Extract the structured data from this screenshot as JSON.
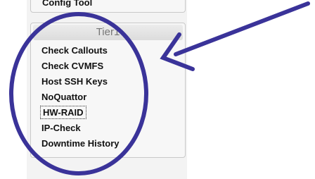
{
  "sidebar": {
    "previous_panel_label": "Config Tool",
    "panel": {
      "title": "Tier1",
      "items": [
        {
          "label": "Check Callouts"
        },
        {
          "label": "Check CVMFS"
        },
        {
          "label": "Host SSH Keys"
        },
        {
          "label": "NoQuattor"
        },
        {
          "label": "HW-RAID"
        },
        {
          "label": "IP-Check"
        },
        {
          "label": "Downtime History"
        }
      ]
    }
  },
  "annotation": {
    "color": "#3a3399",
    "shapes": [
      "ellipse-highlight",
      "arrow-pointer"
    ]
  },
  "colors": {
    "panel_background": "#f7f7f7",
    "header_text": "#777777",
    "border": "#c9c9c9"
  }
}
